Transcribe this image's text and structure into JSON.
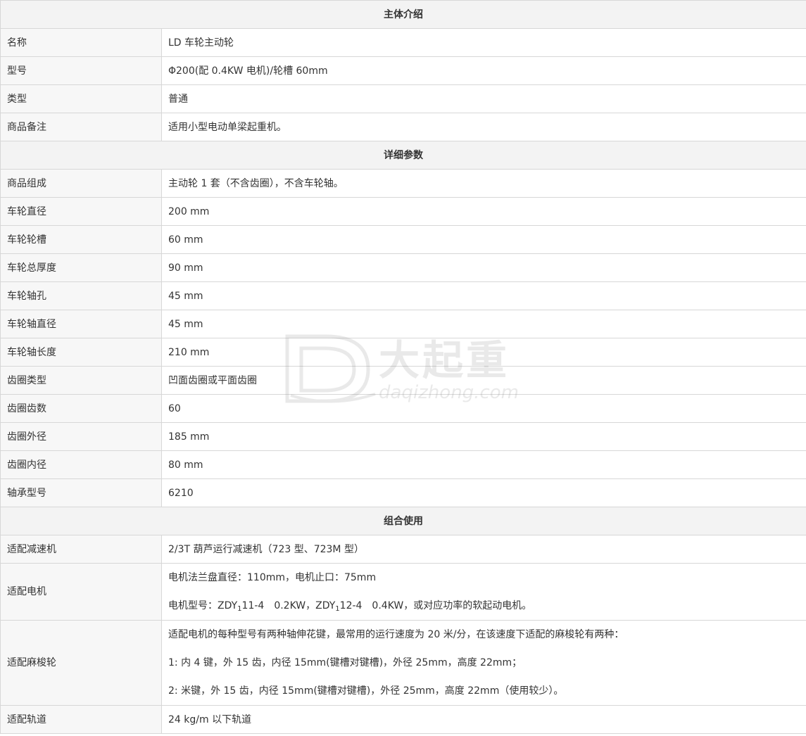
{
  "sections": {
    "intro": "主体介绍",
    "params": "详细参数",
    "combo": "组合使用"
  },
  "intro_rows": [
    {
      "label": "名称",
      "value": "LD 车轮主动轮"
    },
    {
      "label": "型号",
      "value": "Φ200(配 0.4KW 电机)/轮槽 60mm"
    },
    {
      "label": "类型",
      "value": "普通"
    },
    {
      "label": "商品备注",
      "value": "适用小型电动单梁起重机。"
    }
  ],
  "param_rows": [
    {
      "label": "商品组成",
      "value": "主动轮 1 套（不含齿圈），不含车轮轴。"
    },
    {
      "label": "车轮直径",
      "value": "200 mm"
    },
    {
      "label": "车轮轮槽",
      "value": "60 mm"
    },
    {
      "label": "车轮总厚度",
      "value": "90 mm"
    },
    {
      "label": "车轮轴孔",
      "value": "45 mm"
    },
    {
      "label": "车轮轴直径",
      "value": "45 mm"
    },
    {
      "label": "车轮轴长度",
      "value": "210 mm"
    },
    {
      "label": "齿圈类型",
      "value": "凹面齿圈或平面齿圈"
    },
    {
      "label": "齿圈齿数",
      "value": "60"
    },
    {
      "label": "齿圈外径",
      "value": "185 mm"
    },
    {
      "label": "齿圈内径",
      "value": "80 mm"
    },
    {
      "label": "轴承型号",
      "value": "6210"
    }
  ],
  "combo": {
    "reducer": {
      "label": "适配减速机",
      "value": "2/3T 葫芦运行减速机（723 型、723M 型）"
    },
    "motor": {
      "label": "适配电机",
      "line1": "电机法兰盘直径：110mm，电机止口：75mm",
      "line2_prefix": "电机型号：ZDY",
      "sub": "1",
      "line2_mid": "11-4　0.2KW，ZDY",
      "line2_suffix": "12-4　0.4KW，或对应功率的软起动电机。"
    },
    "pinion": {
      "label": "适配麻梭轮",
      "line1": "适配电机的每种型号有两种轴伸花键，最常用的运行速度为 20 米/分，在该速度下适配的麻梭轮有两种：",
      "line2": "1:  内 4 键，外 15 齿，内径 15mm(键槽对键槽)，外径 25mm，高度 22mm；",
      "line3": "2:  米键，外 15 齿，内径 15mm(键槽对键槽)，外径 25mm，高度 22mm（使用较少）。"
    },
    "rail": {
      "label": "适配轨道",
      "value": "24 kg/m 以下轨道"
    }
  },
  "watermark": {
    "brand": "大起重",
    "site": "daqizhong.com",
    "color": "#9a9a9a"
  }
}
